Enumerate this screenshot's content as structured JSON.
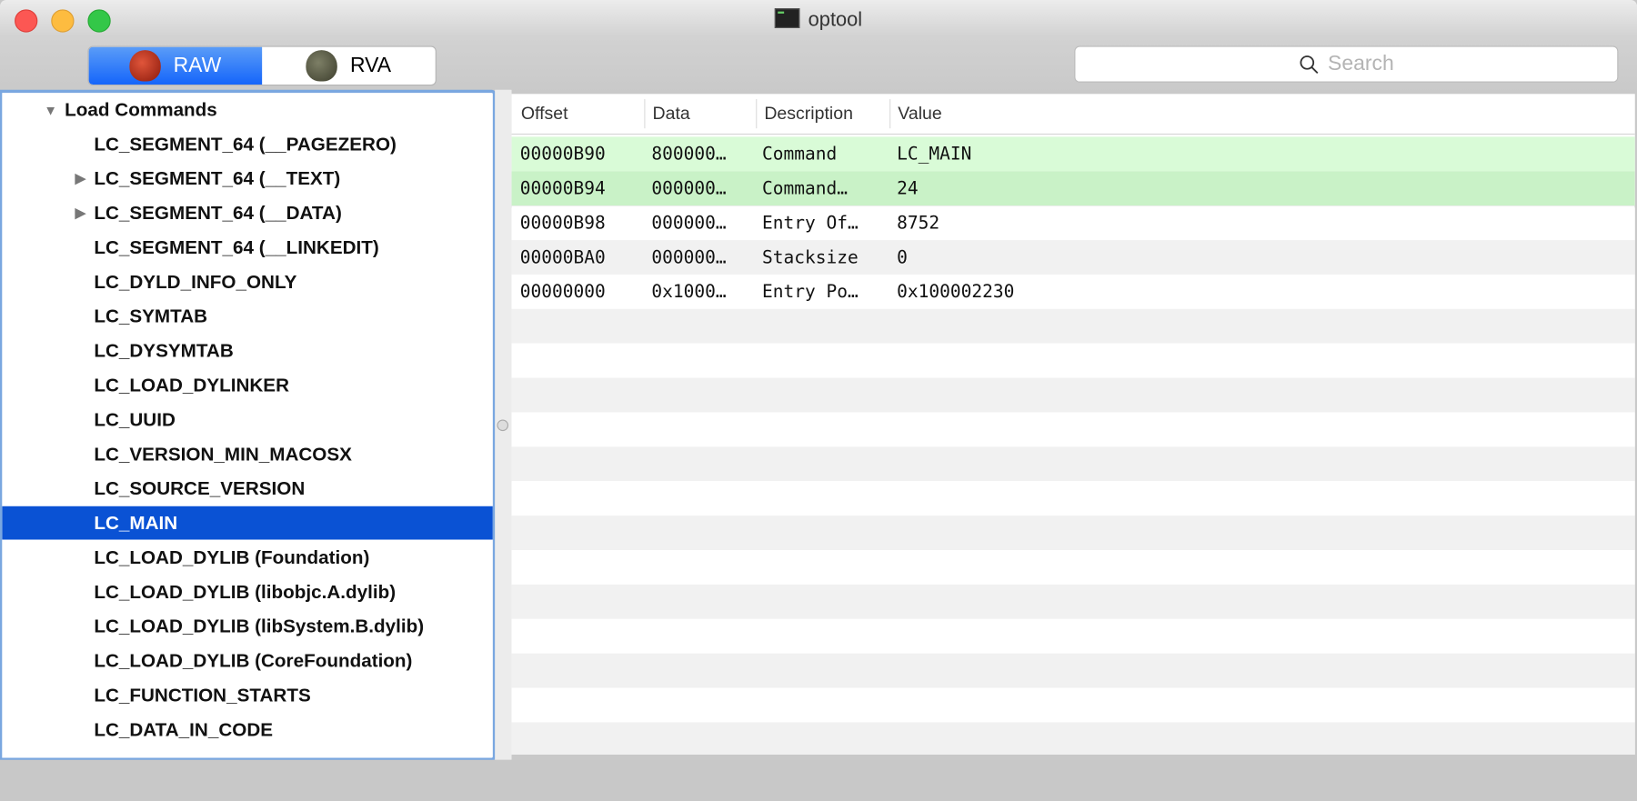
{
  "window": {
    "title": "optool"
  },
  "toolbar": {
    "modes": [
      {
        "label": "RAW",
        "selected": true
      },
      {
        "label": "RVA",
        "selected": false
      }
    ],
    "search_placeholder": "Search"
  },
  "tree": {
    "root": "Load Commands",
    "selected": "LC_MAIN",
    "items": [
      {
        "label": "LC_SEGMENT_64 (__PAGEZERO)",
        "expandable": false
      },
      {
        "label": "LC_SEGMENT_64 (__TEXT)",
        "expandable": true
      },
      {
        "label": "LC_SEGMENT_64 (__DATA)",
        "expandable": true
      },
      {
        "label": "LC_SEGMENT_64 (__LINKEDIT)",
        "expandable": false
      },
      {
        "label": "LC_DYLD_INFO_ONLY",
        "expandable": false
      },
      {
        "label": "LC_SYMTAB",
        "expandable": false
      },
      {
        "label": "LC_DYSYMTAB",
        "expandable": false
      },
      {
        "label": "LC_LOAD_DYLINKER",
        "expandable": false
      },
      {
        "label": "LC_UUID",
        "expandable": false
      },
      {
        "label": "LC_VERSION_MIN_MACOSX",
        "expandable": false
      },
      {
        "label": "LC_SOURCE_VERSION",
        "expandable": false
      },
      {
        "label": "LC_MAIN",
        "expandable": false
      },
      {
        "label": "LC_LOAD_DYLIB (Foundation)",
        "expandable": false
      },
      {
        "label": "LC_LOAD_DYLIB (libobjc.A.dylib)",
        "expandable": false
      },
      {
        "label": "LC_LOAD_DYLIB (libSystem.B.dylib)",
        "expandable": false
      },
      {
        "label": "LC_LOAD_DYLIB (CoreFoundation)",
        "expandable": false
      },
      {
        "label": "LC_FUNCTION_STARTS",
        "expandable": false
      },
      {
        "label": "LC_DATA_IN_CODE",
        "expandable": false
      }
    ]
  },
  "table": {
    "columns": [
      "Offset",
      "Data",
      "Description",
      "Value"
    ],
    "rows": [
      {
        "offset": "00000B90",
        "data": "800000…",
        "description": "Command",
        "value": "LC_MAIN",
        "highlight": "#d9fbd7"
      },
      {
        "offset": "00000B94",
        "data": "000000…",
        "description": "Command…",
        "value": "24",
        "highlight": "#c9f2c7"
      },
      {
        "offset": "00000B98",
        "data": "000000…",
        "description": "Entry Of…",
        "value": "8752"
      },
      {
        "offset": "00000BA0",
        "data": "000000…",
        "description": "Stacksize",
        "value": "0"
      },
      {
        "offset": "00000000",
        "data": "0x1000…",
        "description": "Entry Po…",
        "value": "0x100002230"
      }
    ]
  },
  "colors": {
    "selection": "#0a52d4",
    "focus_ring": "#7aa7e0",
    "stripe": "#f1f1f1"
  }
}
